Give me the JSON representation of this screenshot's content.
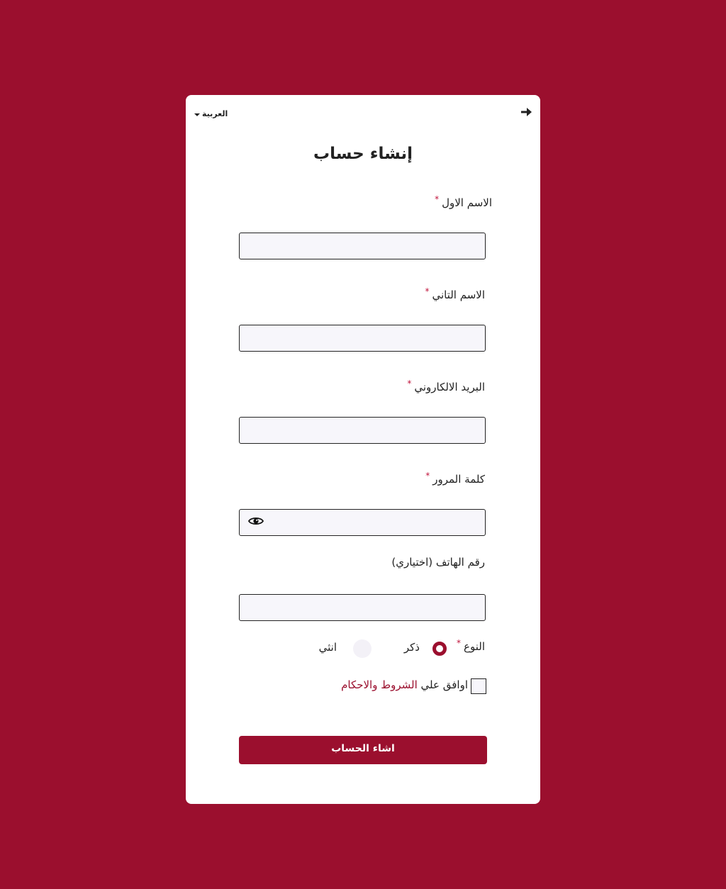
{
  "header": {
    "language": "العربية",
    "title": "إنشاء حساب"
  },
  "fields": {
    "first_name": {
      "label": "الاسم الاول",
      "required_mark": "*",
      "value": ""
    },
    "last_name": {
      "label": "الاسم التاني",
      "required_mark": "*",
      "value": ""
    },
    "email": {
      "label": "البريد الالكاروني",
      "required_mark": "*",
      "value": ""
    },
    "password": {
      "label": "كلمة المرور",
      "required_mark": "*",
      "value": ""
    },
    "phone": {
      "label": "رقم الهاتف (اختياري)",
      "value": ""
    }
  },
  "gender": {
    "label": "النوع",
    "required_mark": "*",
    "options": [
      "ذكر",
      "انثي"
    ],
    "selected": "ذكر"
  },
  "terms": {
    "prefix": "اوافق علي",
    "link": "الشروط والاحكام",
    "checked": false
  },
  "submit_label": "اشاء الحساب",
  "colors": {
    "brand": "#9b0f2e",
    "card": "#ffffff",
    "input_bg": "#f7f6fb"
  },
  "icons": [
    "arrow-right-icon",
    "chevron-down-icon",
    "eye-icon"
  ]
}
